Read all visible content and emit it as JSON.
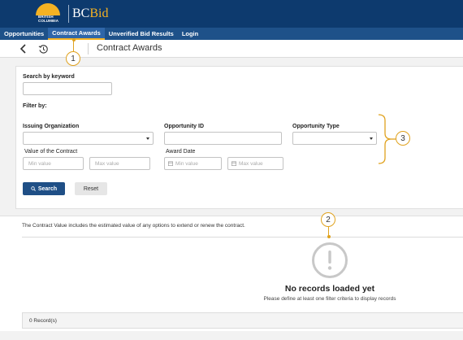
{
  "brand": {
    "logo_lines": [
      "BRITISH",
      "COLUMBIA"
    ],
    "app_name_left": "BC",
    "app_name_right": "Bid"
  },
  "nav": {
    "items": [
      {
        "label": "Opportunities",
        "active": false
      },
      {
        "label": "Contract Awards",
        "active": true
      },
      {
        "label": "Unverified Bid Results",
        "active": false
      },
      {
        "label": "Login",
        "active": false
      }
    ]
  },
  "subheader": {
    "title": "Contract Awards",
    "back_icon": "chevron-left-icon",
    "history_icon": "history-icon"
  },
  "filters": {
    "search_label": "Search by keyword",
    "search_value": "",
    "filter_by": "Filter by:",
    "issuing_org_label": "Issuing Organization",
    "issuing_org_value": "",
    "opportunity_id_label": "Opportunity ID",
    "opportunity_id_value": "",
    "opportunity_type_label": "Opportunity Type",
    "opportunity_type_value": "",
    "contract_value_label": "Value of the Contract",
    "min_value_placeholder": "Min value",
    "max_value_placeholder": "Max value",
    "award_date_label": "Award Date",
    "award_min_placeholder": "Min value",
    "award_max_placeholder": "Max value",
    "search_button": "Search",
    "reset_button": "Reset"
  },
  "results": {
    "notice": "The Contract Value includes the estimated value of any options to extend or renew the contract.",
    "empty_title": "No records loaded yet",
    "empty_subtitle": "Please define at least one filter criteria to display records",
    "records_count": "0 Record(s)"
  },
  "annotations": [
    "1",
    "2",
    "3"
  ],
  "colors": {
    "header_bg": "#0d3a6e",
    "nav_bg": "#1e5189",
    "accent": "#f4b223",
    "primary_button": "#1f4f86",
    "callout": "#e0a21e"
  }
}
